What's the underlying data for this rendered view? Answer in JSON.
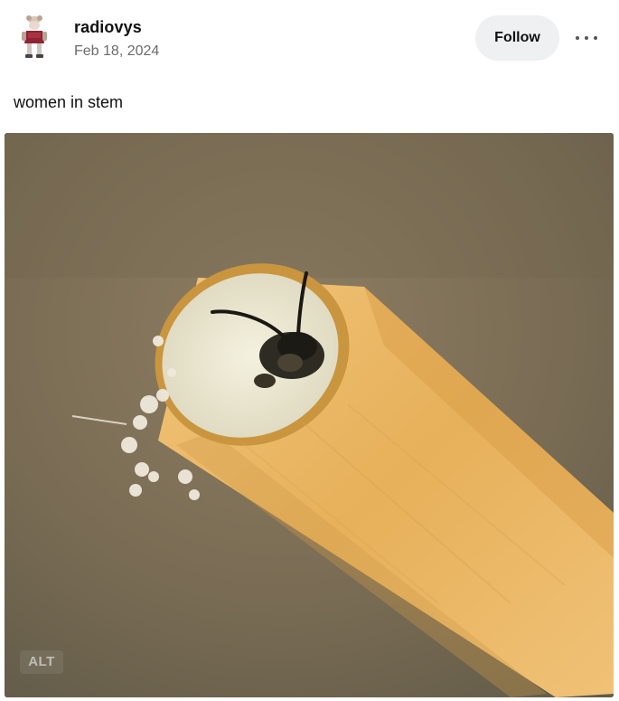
{
  "post": {
    "author": "radiovys",
    "date": "Feb 18, 2024",
    "follow_label": "Follow",
    "caption": "women in stem",
    "image": {
      "alt_badge": "ALT",
      "subject": "wasp-in-cut-stem-photo"
    }
  },
  "icons": {
    "more": "more-options-icon",
    "avatar": "avatar-image"
  },
  "colors": {
    "follow_bg": "#eef0f2",
    "date_text": "#6b6b6b",
    "stem": "#e6b25c"
  }
}
